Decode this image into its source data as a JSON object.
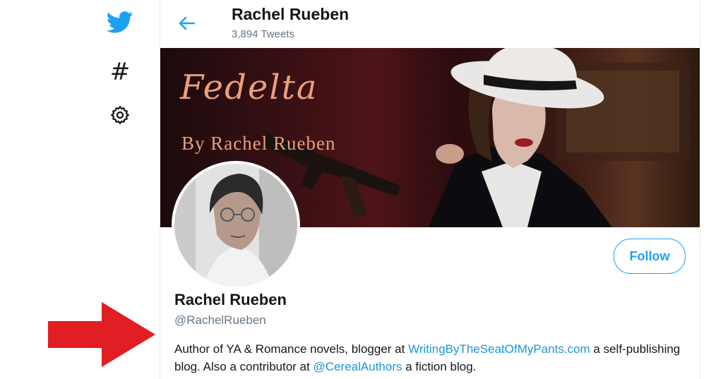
{
  "nav": {
    "logo_icon": "twitter-bird-icon",
    "explore_icon": "#",
    "settings_icon": "gear-icon"
  },
  "header": {
    "name": "Rachel Rueben",
    "tweet_count": "3,894 Tweets"
  },
  "banner": {
    "title": "Fedelta",
    "subtitle": "By Rachel Rueben"
  },
  "profile": {
    "follow_label": "Follow",
    "display_name": "Rachel Rueben",
    "handle": "@RachelRueben",
    "bio_part1": "Author of YA & Romance novels, blogger at ",
    "bio_link1": "WritingByTheSeatOfMyPants.com",
    "bio_part2": " a self-publishing blog.  Also a contributor at ",
    "bio_link2": "@CerealAuthors",
    "bio_part3": " a fiction blog."
  },
  "colors": {
    "accent": "#1da1f2",
    "arrow": "#e01e24"
  }
}
